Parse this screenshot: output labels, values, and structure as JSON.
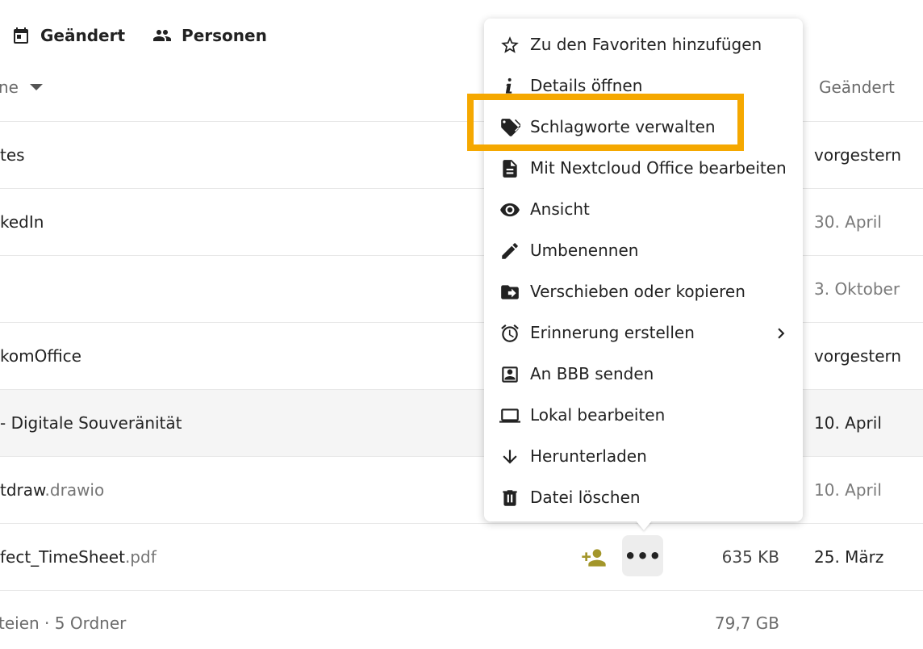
{
  "filters": {
    "modified_label": "Geändert",
    "people_label": "Personen"
  },
  "table": {
    "name_header": "ne",
    "modified_header": "Geändert",
    "rows": [
      {
        "name": "tes",
        "ext": "",
        "date": "vorgestern"
      },
      {
        "name": "kedIn",
        "ext": "",
        "date": "30. April"
      },
      {
        "name": "",
        "ext": "",
        "date": "3. Oktober"
      },
      {
        "name": "komOffice",
        "ext": "",
        "date": "vorgestern"
      },
      {
        "name": " - Digitale Souveränität",
        "ext": "",
        "date": "10. April"
      },
      {
        "name": "tdraw",
        "ext": ".drawio",
        "date": "10. April"
      },
      {
        "name": "fect_TimeSheet",
        "ext": ".pdf",
        "size": "635 KB",
        "date": "25. März"
      }
    ],
    "more_label": "•••"
  },
  "footer": {
    "summary": "teien · 5 Ordner",
    "total_size": "79,7 GB"
  },
  "context_menu": {
    "items": [
      {
        "label": "Zu den Favoriten hinzufügen",
        "icon": "star-outline-icon"
      },
      {
        "label": "Details öffnen",
        "icon": "info-icon"
      },
      {
        "label": "Schlagworte verwalten",
        "icon": "tag-icon"
      },
      {
        "label": "Mit Nextcloud Office bearbeiten",
        "icon": "document-icon"
      },
      {
        "label": "Ansicht",
        "icon": "eye-icon"
      },
      {
        "label": "Umbenennen",
        "icon": "pencil-icon"
      },
      {
        "label": "Verschieben oder kopieren",
        "icon": "folder-move-icon"
      },
      {
        "label": "Erinnerung erstellen",
        "icon": "alarm-icon"
      },
      {
        "label": "An BBB senden",
        "icon": "account-box-icon"
      },
      {
        "label": "Lokal bearbeiten",
        "icon": "laptop-icon"
      },
      {
        "label": "Herunterladen",
        "icon": "download-arrow-icon"
      },
      {
        "label": "Datei löschen",
        "icon": "trash-icon"
      }
    ]
  },
  "colors": {
    "highlight": "#f5a800",
    "share_icon": "#a3962a"
  }
}
